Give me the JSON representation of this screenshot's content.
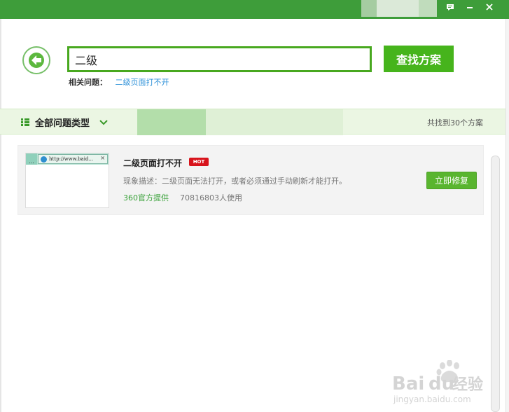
{
  "search": {
    "value": "二级",
    "button_label": "查找方案"
  },
  "related": {
    "label": "相关问题：",
    "link": "二级页面打不开"
  },
  "category": {
    "dropdown_label": "全部问题类型",
    "count_text": "共找到30个方案"
  },
  "result": {
    "thumb_tab_text": "http://www.baid...",
    "title": "二级页面打不开",
    "badge": "HOT",
    "description": "现象描述：二级页面无法打开，或者必须通过手动刷新才能打开。",
    "source": "360官方提供",
    "users": "70816803人使用",
    "fix_button": "立即修复"
  },
  "watermark": {
    "brand": "Bai",
    "brand_tail": "经验",
    "url": "jingyan.baidu.com"
  },
  "colors": {
    "titlebar": "#3e9d3a",
    "accent_green": "#46b41c",
    "link_blue": "#2a8fd8",
    "hot_red": "#d8141c"
  }
}
